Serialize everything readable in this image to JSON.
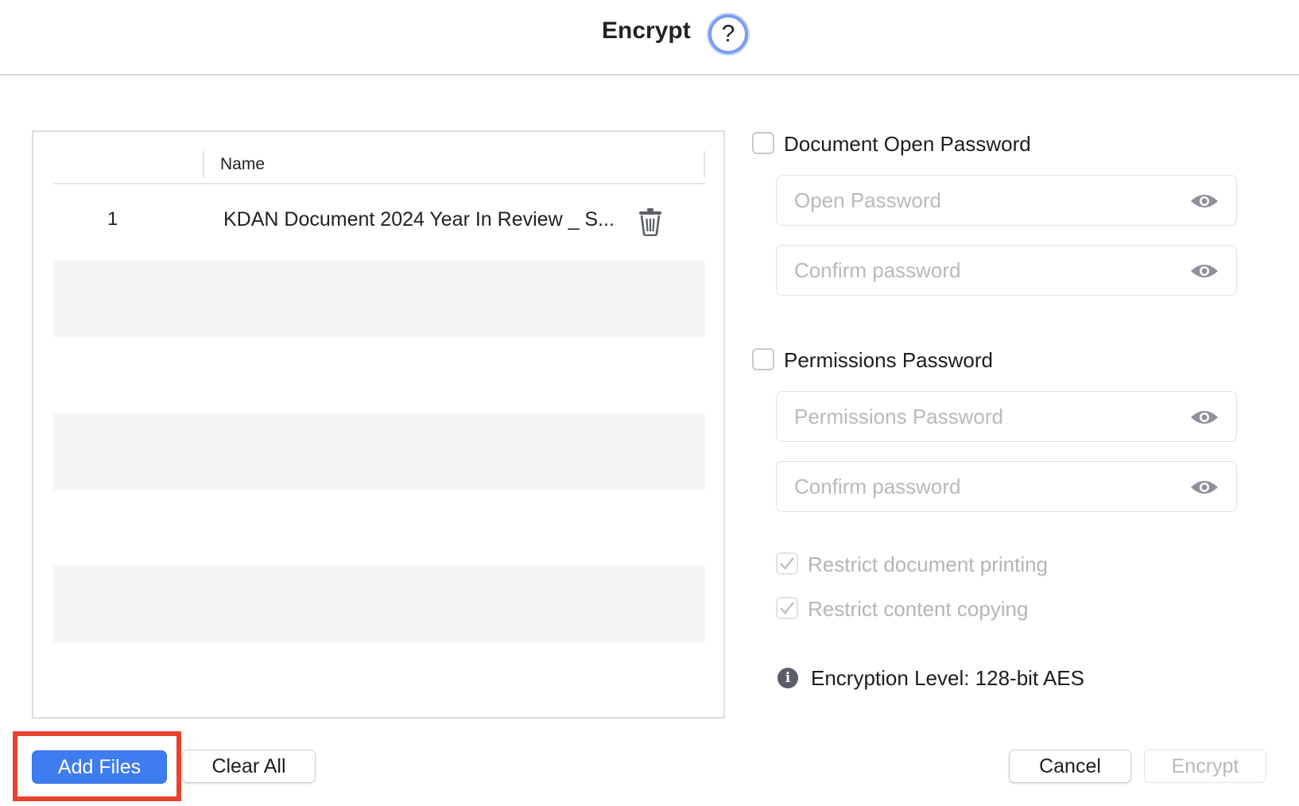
{
  "header": {
    "title": "Encrypt",
    "help_label": "?"
  },
  "file_list": {
    "column_name": "Name",
    "rows": [
      {
        "index": "1",
        "name": "KDAN Document 2024 Year In Review _ S..."
      }
    ]
  },
  "buttons": {
    "add_files": "Add Files",
    "clear_all": "Clear All",
    "cancel": "Cancel",
    "encrypt": "Encrypt"
  },
  "open_password": {
    "label": "Document Open Password",
    "password_placeholder": "Open Password",
    "confirm_placeholder": "Confirm password"
  },
  "permissions_password": {
    "label": "Permissions Password",
    "password_placeholder": "Permissions Password",
    "confirm_placeholder": "Confirm password",
    "restrict_printing": "Restrict document printing",
    "restrict_copying": "Restrict content copying"
  },
  "encryption_level": "Encryption Level: 128-bit AES",
  "colors": {
    "accent": "#3e7cf0",
    "highlight": "#e8432d"
  }
}
